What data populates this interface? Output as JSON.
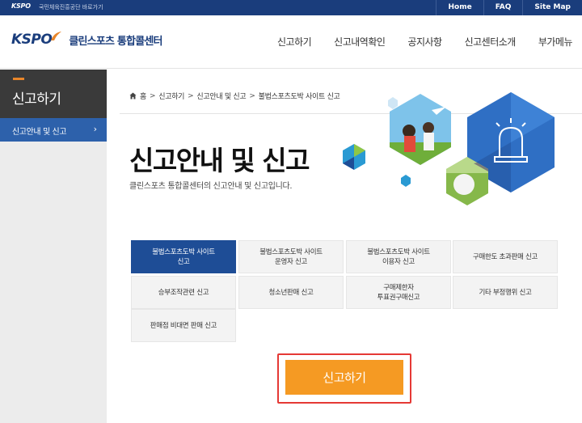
{
  "topbar": {
    "brand": "KSPO",
    "brand_link": "국민체육진흥공단 바로가기",
    "links": [
      "Home",
      "FAQ",
      "Site Map"
    ]
  },
  "header": {
    "logo_mark": "KSPO",
    "logo_name_1": "클린스포츠",
    "logo_name_2": "통합콜센터",
    "nav": [
      "신고하기",
      "신고내역확인",
      "공지사항",
      "신고센터소개",
      "부가메뉴"
    ]
  },
  "sidebar": {
    "title": "신고하기",
    "items": [
      {
        "label": "신고안내 및 신고",
        "arrow": "›"
      }
    ]
  },
  "breadcrumb": [
    "홈",
    "신고하기",
    "신고안내 및 신고",
    "불법스포츠도박 사이트 신고"
  ],
  "page": {
    "title": "신고안내 및 신고",
    "description": "클린스포츠 통합콜센터의 신고안내 및 신고입니다."
  },
  "report_types": [
    {
      "line1": "불법스포츠도박 사이트",
      "line2": "신고",
      "active": true
    },
    {
      "line1": "불법스포츠도박 사이트",
      "line2": "운영자 신고",
      "active": false
    },
    {
      "line1": "불법스포츠도박 사이트",
      "line2": "이용자 신고",
      "active": false
    },
    {
      "line1": "구매한도 초과판매 신고",
      "line2": "",
      "active": false
    },
    {
      "line1": "승부조작관련 신고",
      "line2": "",
      "active": false
    },
    {
      "line1": "청소년판매 신고",
      "line2": "",
      "active": false
    },
    {
      "line1": "구매제한자",
      "line2": "투표권구매신고",
      "active": false
    },
    {
      "line1": "기타 부정행위 신고",
      "line2": "",
      "active": false
    },
    {
      "line1": "판매점 비대면 판매 신고",
      "line2": "",
      "active": false
    }
  ],
  "report_button": {
    "label": "신고하기"
  },
  "colors": {
    "navy": "#1a3d7c",
    "active_tile": "#1e4d96",
    "sidebar_active": "#2d61ab",
    "button": "#f59a23",
    "highlight": "#e53935"
  }
}
